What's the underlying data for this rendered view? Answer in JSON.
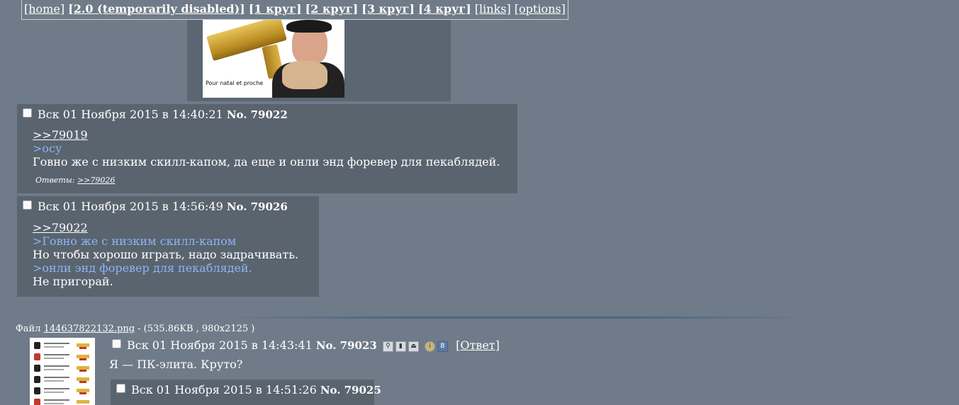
{
  "nav": {
    "home": "[home]",
    "v2": "[2.0 (temporarily disabled)]",
    "k1": "[1 круг]",
    "k2": "[2 круг]",
    "k3": "[3 круг]",
    "k4": "[4 круг]",
    "links": "[links]",
    "options": "[options]"
  },
  "image_post": {
    "caption": "Pour natal et proche"
  },
  "posts": [
    {
      "date": "Вск 01 Ноября 2015 в 14:40:21",
      "no_label": "No.",
      "no": "79022",
      "lines": [
        {
          "text": ">>79019",
          "kind": "ref"
        },
        {
          "text": ">осу",
          "kind": "quote"
        },
        {
          "text": "Говно же с низким скилл-капом, да еще и онли энд форевер для пекаблядей.",
          "kind": "text"
        }
      ],
      "answers_label": "Ответы:",
      "answers_ref": ">>79026"
    },
    {
      "date": "Вск 01 Ноября 2015 в 14:56:49",
      "no_label": "No.",
      "no": "79026",
      "lines": [
        {
          "text": ">>79022",
          "kind": "ref"
        },
        {
          "text": ">Говно же с низким скилл-капом",
          "kind": "quote"
        },
        {
          "text": "Но чтобы хорошо играть, надо задрачивать.",
          "kind": "text"
        },
        {
          "text": ">онли энд форевер для пекаблядей.",
          "kind": "quote"
        },
        {
          "text": "Не пригорай.",
          "kind": "text"
        }
      ]
    }
  ],
  "thread": {
    "file_label": "Файл",
    "file_name": "144637822132.png",
    "file_meta": "- (535.86KB , 980x2125 )",
    "date": "Вск 01 Ноября 2015 в 14:43:41",
    "no_label": "No.",
    "no": "79023",
    "reply_link": "[Ответ]",
    "text": "Я — ПК-элита. Круто?",
    "tool_icons": [
      "search-icon",
      "bookmark-icon",
      "hide-icon",
      "info-icon",
      "vk-share-icon"
    ]
  },
  "last_reply": {
    "date": "Вск 01 Ноября 2015 в 14:51:26",
    "no_label": "No.",
    "no": "79025"
  }
}
